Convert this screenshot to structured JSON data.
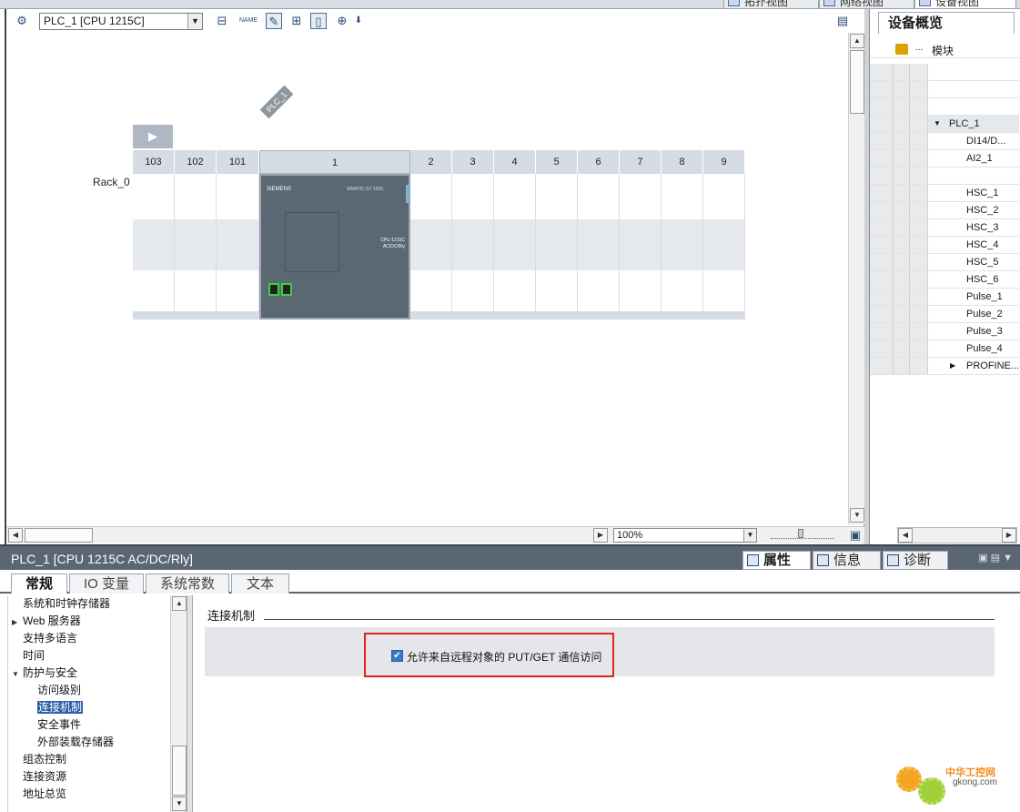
{
  "view_tabs": [
    {
      "label": "拓扑视图",
      "active": false
    },
    {
      "label": "网络视图",
      "active": false
    },
    {
      "label": "设备视图",
      "active": true
    }
  ],
  "toolbar": {
    "device_select": "PLC_1 [CPU 1215C]"
  },
  "rack": {
    "label": "Rack_0",
    "plc_tag": "PLC_1",
    "slots": [
      "103",
      "102",
      "101",
      "1",
      "2",
      "3",
      "4",
      "5",
      "6",
      "7",
      "8",
      "9"
    ],
    "cpu_brand": "SIEMENS",
    "cpu_model": "SIMATIC S7-1200",
    "cpu_text_1": "CPU 1215C",
    "cpu_text_2": "AC/DC/Rly"
  },
  "canvas": {
    "zoom": "100%"
  },
  "overview": {
    "title": "设备概览",
    "column_header": "模块",
    "rows": [
      {
        "label": "",
        "indent": 0,
        "caret": ""
      },
      {
        "label": "",
        "indent": 0,
        "caret": ""
      },
      {
        "label": "",
        "indent": 0,
        "caret": ""
      },
      {
        "label": "PLC_1",
        "indent": 1,
        "caret": "▼"
      },
      {
        "label": "DI14/D...",
        "indent": 2,
        "caret": ""
      },
      {
        "label": "AI2_1",
        "indent": 2,
        "caret": ""
      },
      {
        "label": "",
        "indent": 2,
        "caret": ""
      },
      {
        "label": "HSC_1",
        "indent": 2,
        "caret": ""
      },
      {
        "label": "HSC_2",
        "indent": 2,
        "caret": ""
      },
      {
        "label": "HSC_3",
        "indent": 2,
        "caret": ""
      },
      {
        "label": "HSC_4",
        "indent": 2,
        "caret": ""
      },
      {
        "label": "HSC_5",
        "indent": 2,
        "caret": ""
      },
      {
        "label": "HSC_6",
        "indent": 2,
        "caret": ""
      },
      {
        "label": "Pulse_1",
        "indent": 2,
        "caret": ""
      },
      {
        "label": "Pulse_2",
        "indent": 2,
        "caret": ""
      },
      {
        "label": "Pulse_3",
        "indent": 2,
        "caret": ""
      },
      {
        "label": "Pulse_4",
        "indent": 2,
        "caret": ""
      },
      {
        "label": "PROFINE...",
        "indent": 2,
        "caret": "▶"
      }
    ]
  },
  "inspector": {
    "title": "PLC_1 [CPU 1215C AC/DC/Rly]",
    "tabs": [
      {
        "label": "属性",
        "active": true
      },
      {
        "label": "信息",
        "active": false
      },
      {
        "label": "诊断",
        "active": false
      }
    ],
    "sub_tabs": [
      {
        "label": "常规",
        "active": true
      },
      {
        "label": "IO 变量",
        "active": false
      },
      {
        "label": "系统常数",
        "active": false
      },
      {
        "label": "文本",
        "active": false
      }
    ],
    "nav": [
      {
        "label": "系统和时钟存储器",
        "indent": 0,
        "caret": "",
        "selected": false
      },
      {
        "label": "Web 服务器",
        "indent": 0,
        "caret": "▶",
        "selected": false
      },
      {
        "label": "支持多语言",
        "indent": 0,
        "caret": "",
        "selected": false
      },
      {
        "label": "时间",
        "indent": 0,
        "caret": "",
        "selected": false
      },
      {
        "label": "防护与安全",
        "indent": 0,
        "caret": "▼",
        "selected": false
      },
      {
        "label": "访问级别",
        "indent": 1,
        "caret": "",
        "selected": false
      },
      {
        "label": "连接机制",
        "indent": 1,
        "caret": "",
        "selected": true
      },
      {
        "label": "安全事件",
        "indent": 1,
        "caret": "",
        "selected": false
      },
      {
        "label": "外部装载存储器",
        "indent": 1,
        "caret": "",
        "selected": false
      },
      {
        "label": "组态控制",
        "indent": 0,
        "caret": "",
        "selected": false
      },
      {
        "label": "连接资源",
        "indent": 0,
        "caret": "",
        "selected": false
      },
      {
        "label": "地址总览",
        "indent": 0,
        "caret": "",
        "selected": false
      }
    ],
    "section_title": "连接机制",
    "putget_checked": true,
    "putget_label": "允许来自远程对象的 PUT/GET 通信访问"
  },
  "watermark": {
    "name": "中华工控网",
    "url": "gkong.com"
  }
}
